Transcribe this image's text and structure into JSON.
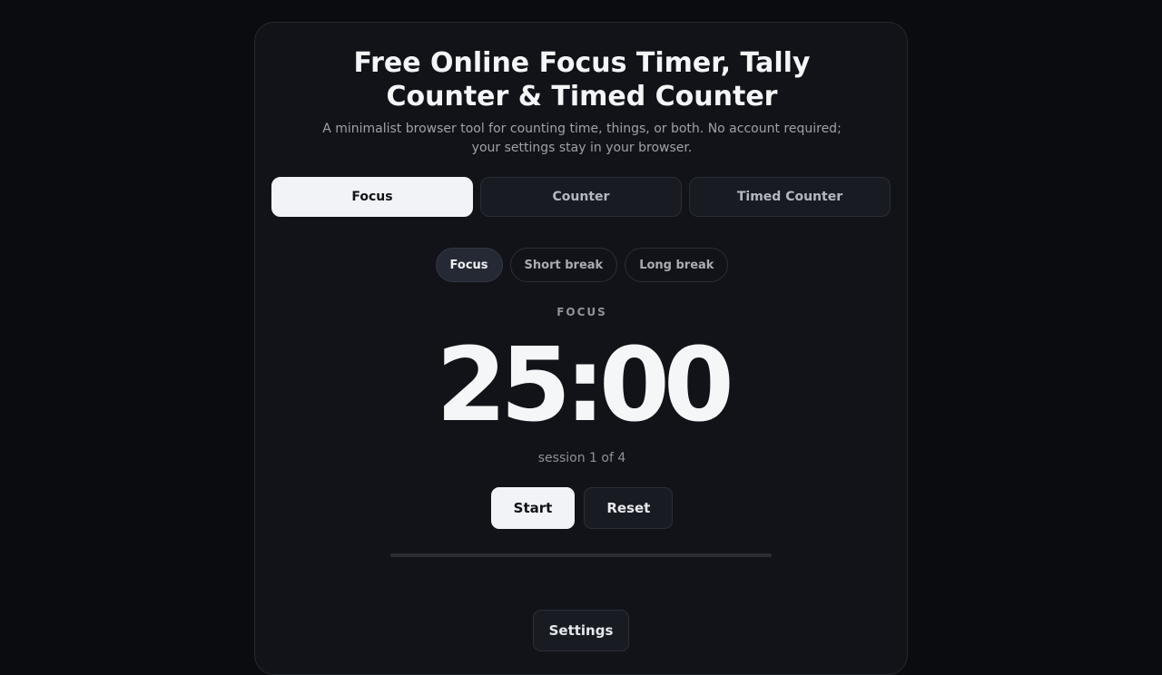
{
  "header": {
    "title": "Free Online Focus Timer, Tally Counter & Timed Counter",
    "subtitle": "A minimalist browser tool for counting time, things, or both. No account required; your settings stay in your browser."
  },
  "modes": {
    "tabs": [
      {
        "label": "Focus",
        "active": true
      },
      {
        "label": "Counter",
        "active": false
      },
      {
        "label": "Timed Counter",
        "active": false
      }
    ]
  },
  "phases": {
    "items": [
      {
        "label": "Focus",
        "active": true
      },
      {
        "label": "Short break",
        "active": false
      },
      {
        "label": "Long break",
        "active": false
      }
    ]
  },
  "timer": {
    "phase_label": "FOCUS",
    "time": "25:00",
    "session": "session 1 of 4",
    "progress": 0
  },
  "controls": {
    "start_label": "Start",
    "reset_label": "Reset"
  },
  "footer": {
    "settings_label": "Settings"
  },
  "colors": {
    "background": "#0b0c10",
    "card": "#121318",
    "accent": "#f2f3f6"
  }
}
